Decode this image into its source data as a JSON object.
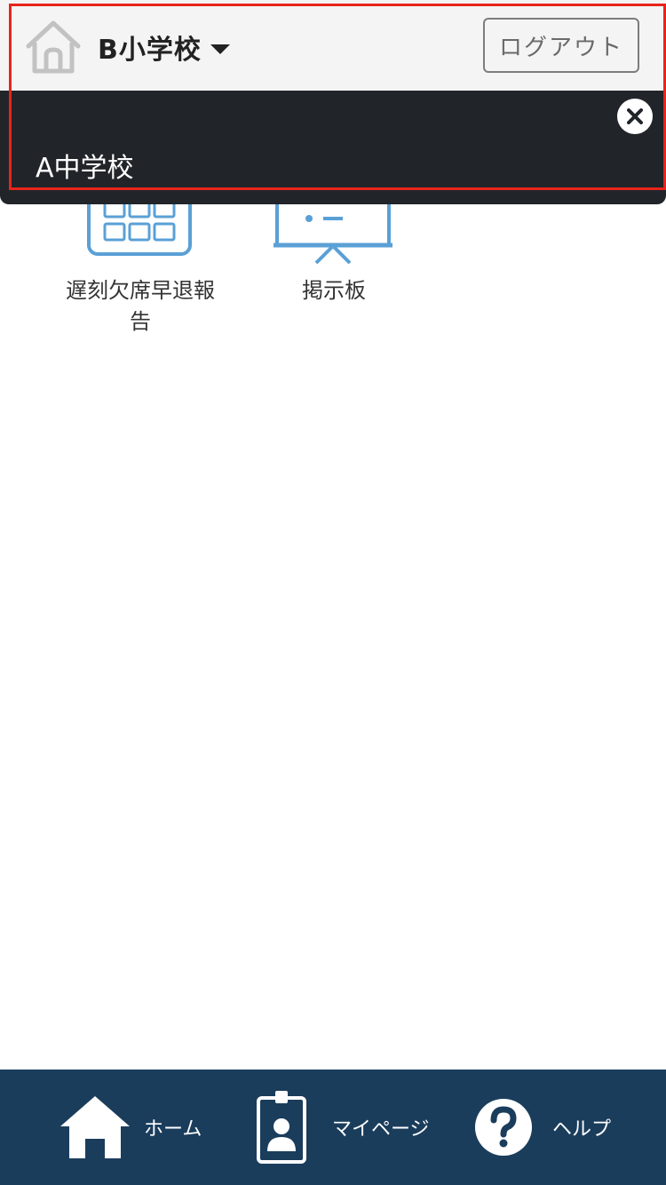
{
  "header": {
    "school_name": "B小学校",
    "logout_label": "ログアウト"
  },
  "dropdown": {
    "options": [
      {
        "label": "A中学校"
      }
    ]
  },
  "menu": {
    "items": [
      {
        "label_line1": "遅刻欠席早退報",
        "label_line2": "告",
        "icon": "calendar-icon"
      },
      {
        "label": "掲示板",
        "icon": "bulletin-board-icon"
      }
    ]
  },
  "bottom_nav": {
    "items": [
      {
        "label": "ホーム",
        "icon": "home-icon"
      },
      {
        "label": "マイページ",
        "icon": "id-badge-icon"
      },
      {
        "label": "ヘルプ",
        "icon": "help-icon"
      }
    ]
  },
  "colors": {
    "header_bg": "#f4f4f4",
    "dropdown_bg": "#212529",
    "highlight": "#e8241b",
    "icon_blue": "#5aa0d6",
    "nav_bg": "#1b3d5c"
  }
}
